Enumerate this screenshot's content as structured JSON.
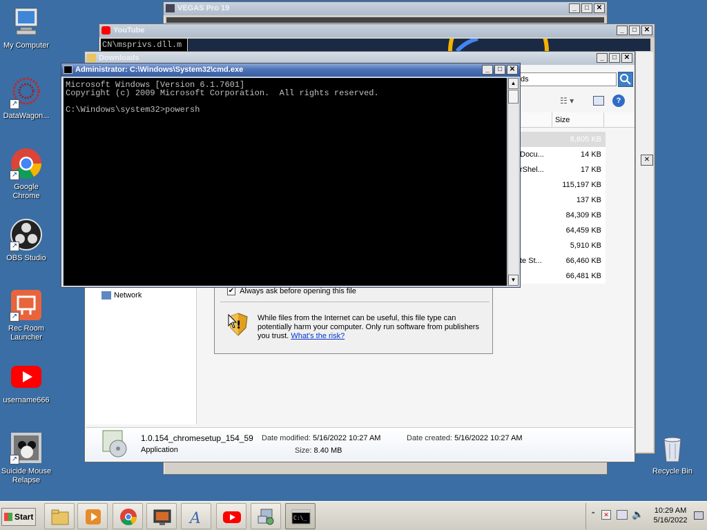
{
  "desktop": {
    "icons": [
      {
        "label": "My Computer",
        "icon": "computer-icon"
      },
      {
        "label": "DataWagon...",
        "icon": "datawagon-icon"
      },
      {
        "label": "Google Chrome",
        "icon": "chrome-icon"
      },
      {
        "label": "OBS Studio",
        "icon": "obs-icon"
      },
      {
        "label": "Rec Room Launcher",
        "icon": "recroom-icon"
      },
      {
        "label": "username666",
        "icon": "youtube-icon"
      },
      {
        "label": "Suicide Mouse Relapse",
        "icon": "game-icon"
      },
      {
        "label": "Recycle Bin",
        "icon": "recycle-bin-icon"
      }
    ]
  },
  "windows": {
    "vegas": {
      "title": "VEGAS Pro 19"
    },
    "youtube": {
      "title": "YouTube",
      "console_text": "CN\\msprivs.dll.m"
    },
    "downloads": {
      "title": "Downloads",
      "search_text": "ds",
      "column_size": "Size",
      "files": [
        {
          "name": "",
          "size": "8,605 KB"
        },
        {
          "name": "Docu...",
          "size": "14 KB"
        },
        {
          "name": "rShel...",
          "size": "17 KB"
        },
        {
          "name": "",
          "size": "115,197 KB"
        },
        {
          "name": "",
          "size": "137 KB"
        },
        {
          "name": "",
          "size": "84,309 KB"
        },
        {
          "name": "",
          "size": "64,459 KB"
        },
        {
          "name": "",
          "size": "5,910 KB"
        },
        {
          "name": "te St...",
          "size": "66,460 KB"
        },
        {
          "name": "",
          "size": "66,481 KB"
        }
      ],
      "nav_network": "Network",
      "details": {
        "filename": "1.0.154_chromesetup_154_59",
        "type": "Application",
        "date_modified_label": "Date modified:",
        "date_modified": "5/16/2022 10:27 AM",
        "date_created_label": "Date created:",
        "date_created": "5/16/2022 10:27 AM",
        "size_label": "Size:",
        "size": "8.40 MB"
      }
    },
    "security": {
      "checkbox_label": "Always ask before opening this file",
      "warning_text_1": "While files from the Internet can be useful, this file type can",
      "warning_text_2": "potentially harm your computer. Only run software from publishers",
      "warning_text_3": "you trust.",
      "risk_link": "What's the risk?"
    },
    "cmd": {
      "title": "Administrator: C:\\Windows\\System32\\cmd.exe",
      "line1": "Microsoft Windows [Version 6.1.7601]",
      "line2": "Copyright (c) 2009 Microsoft Corporation.  All rights reserved.",
      "line3": "C:\\Windows\\system32>powersh"
    }
  },
  "taskbar": {
    "start_label": "Start",
    "pinned": [
      "explorer-icon",
      "media-player-icon",
      "chrome-icon",
      "screen-recorder-icon",
      "font-icon",
      "youtube-icon",
      "network-setup-icon",
      "cmd-icon"
    ],
    "clock_time": "10:29 AM",
    "clock_date": "5/16/2022"
  },
  "colors": {
    "desktop": "#3a6ea5",
    "titlebar_active": "#4d72b8",
    "cmd_bg": "#000000",
    "cmd_text": "#c0c0c0",
    "link": "#0033cc"
  }
}
